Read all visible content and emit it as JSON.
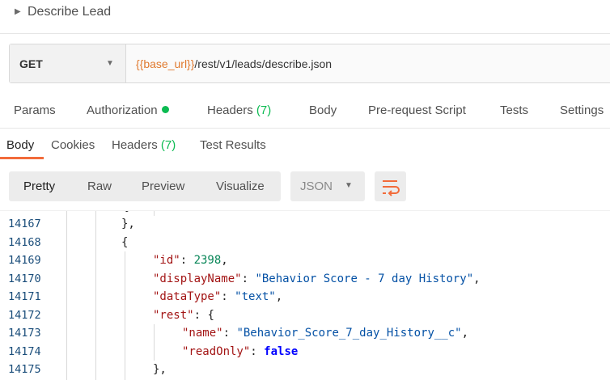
{
  "request": {
    "title": "Describe Lead",
    "method": "GET",
    "url_var": "{{base_url}}",
    "url_path": "/rest/v1/leads/describe.json"
  },
  "request_tabs": {
    "params": "Params",
    "authorization": "Authorization",
    "headers": "Headers",
    "headers_count": "(7)",
    "body": "Body",
    "prerequest": "Pre-request Script",
    "tests": "Tests",
    "settings": "Settings"
  },
  "response_tabs": {
    "body": "Body",
    "cookies": "Cookies",
    "headers": "Headers",
    "headers_count": "(7)",
    "test_results": "Test Results"
  },
  "toolbar": {
    "pretty": "Pretty",
    "raw": "Raw",
    "preview": "Preview",
    "visualize": "Visualize",
    "format": "JSON"
  },
  "code": {
    "line_numbers": [
      "14167",
      "14168",
      "14169",
      "14170",
      "14171",
      "14172",
      "14173",
      "14174",
      "14175"
    ],
    "top_partial": "}",
    "close_obj": "},",
    "open_obj": "{",
    "id_key": "\"id\"",
    "id_val": "2398",
    "display_key": "\"displayName\"",
    "display_val": "\"Behavior Score - 7 day History\"",
    "datatype_key": "\"dataType\"",
    "datatype_val": "\"text\"",
    "rest_key": "\"rest\"",
    "rest_open": "{",
    "name_key": "\"name\"",
    "name_val": "\"Behavior_Score_7_day_History__c\"",
    "readonly_key": "\"readOnly\"",
    "readonly_val": "false",
    "rest_close": "},"
  },
  "colors": {
    "accent_orange": "#f26b3a",
    "status_green": "#0cbb52"
  }
}
